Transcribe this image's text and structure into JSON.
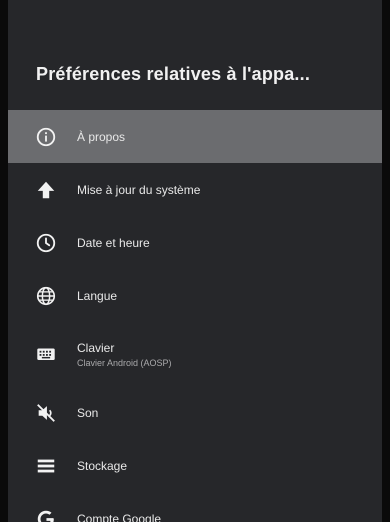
{
  "header": {
    "title": "Préférences relatives à l'appa..."
  },
  "menu": {
    "items": [
      {
        "label": "À propos",
        "icon": "info-icon",
        "selected": true
      },
      {
        "label": "Mise à jour du système",
        "icon": "upload-arrow-icon"
      },
      {
        "label": "Date et heure",
        "icon": "clock-icon"
      },
      {
        "label": "Langue",
        "icon": "globe-icon"
      },
      {
        "label": "Clavier",
        "sublabel": "Clavier Android (AOSP)",
        "icon": "keyboard-icon"
      },
      {
        "label": "Son",
        "icon": "speaker-muted-icon"
      },
      {
        "label": "Stockage",
        "icon": "storage-icon"
      },
      {
        "label": "Compte Google",
        "icon": "google-icon"
      }
    ]
  }
}
